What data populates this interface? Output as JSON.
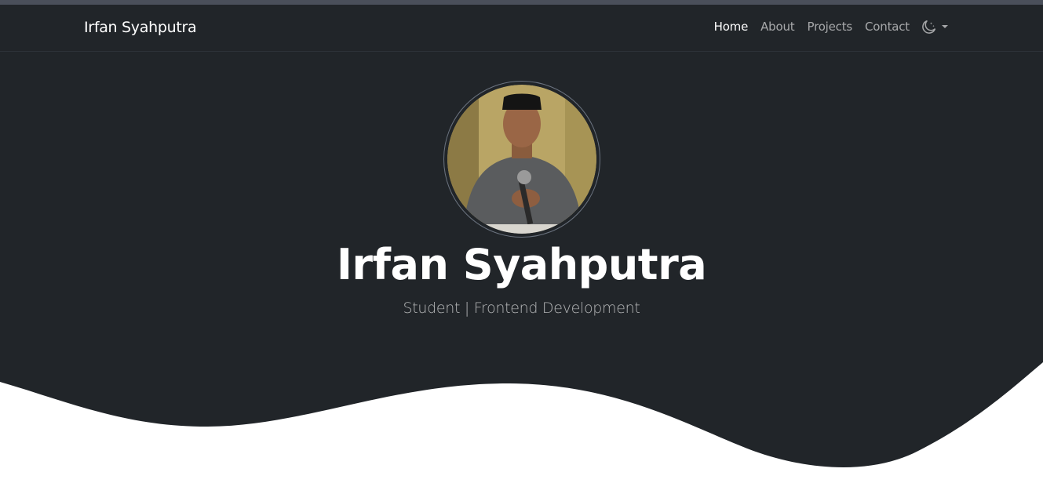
{
  "navbar": {
    "brand": "Irfan Syahputra",
    "links": [
      {
        "label": "Home",
        "active": true
      },
      {
        "label": "About",
        "active": false
      },
      {
        "label": "Projects",
        "active": false
      },
      {
        "label": "Contact",
        "active": false
      }
    ],
    "theme_toggle_icon": "moon-stars-icon"
  },
  "hero": {
    "name": "Irfan Syahputra",
    "subtitle": "Student | Frontend Development",
    "avatar_icon": "profile-photo"
  },
  "colors": {
    "background_dark": "#212529",
    "text_primary": "#ffffff",
    "page_bg": "#ffffff"
  }
}
